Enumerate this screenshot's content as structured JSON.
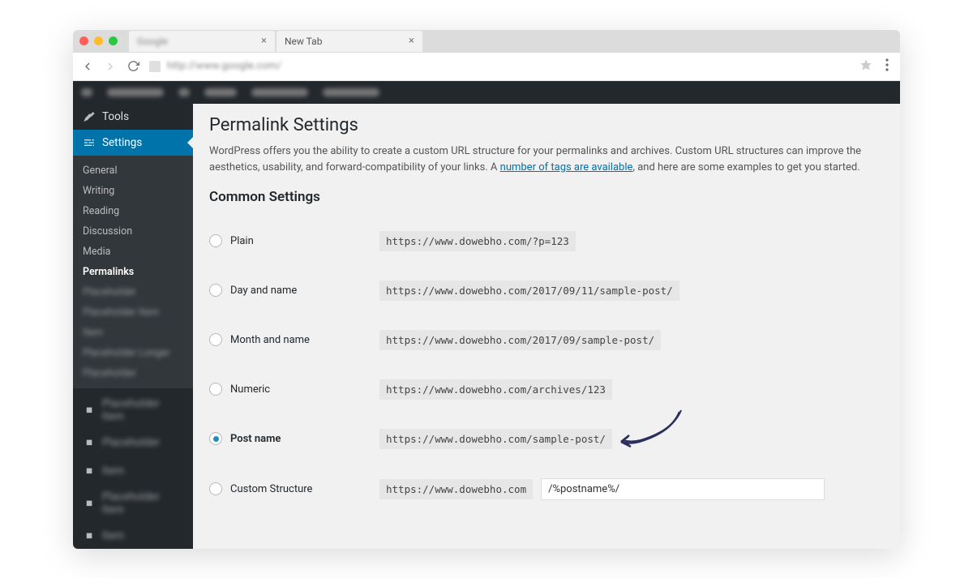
{
  "browser": {
    "tabs": [
      {
        "title": "Google",
        "blurred": true
      },
      {
        "title": "New Tab",
        "blurred": false
      }
    ],
    "url": "http://www.google.com/"
  },
  "sidebar": {
    "tools_label": "Tools",
    "settings_label": "Settings",
    "submenu": {
      "general": "General",
      "writing": "Writing",
      "reading": "Reading",
      "discussion": "Discussion",
      "media": "Media",
      "permalinks": "Permalinks"
    }
  },
  "page": {
    "heading": "Permalink Settings",
    "intro_before_link": "WordPress offers you the ability to create a custom URL structure for your permalinks and archives. Custom URL structures can improve the aesthetics, usability, and forward-compatibility of your links. A ",
    "intro_link": "number of tags are available",
    "intro_after_link": ", and here are some examples to get you started.",
    "section_heading": "Common Settings",
    "options": {
      "plain": {
        "label": "Plain",
        "example": "https://www.dowebho.com/?p=123"
      },
      "day_name": {
        "label": "Day and name",
        "example": "https://www.dowebho.com/2017/09/11/sample-post/"
      },
      "month_name": {
        "label": "Month and name",
        "example": "https://www.dowebho.com/2017/09/sample-post/"
      },
      "numeric": {
        "label": "Numeric",
        "example": "https://www.dowebho.com/archives/123"
      },
      "post_name": {
        "label": "Post name",
        "example": "https://www.dowebho.com/sample-post/"
      },
      "custom": {
        "label": "Custom Structure",
        "prefix": "https://www.dowebho.com",
        "value": "/%postname%/"
      }
    },
    "selected": "post_name"
  }
}
